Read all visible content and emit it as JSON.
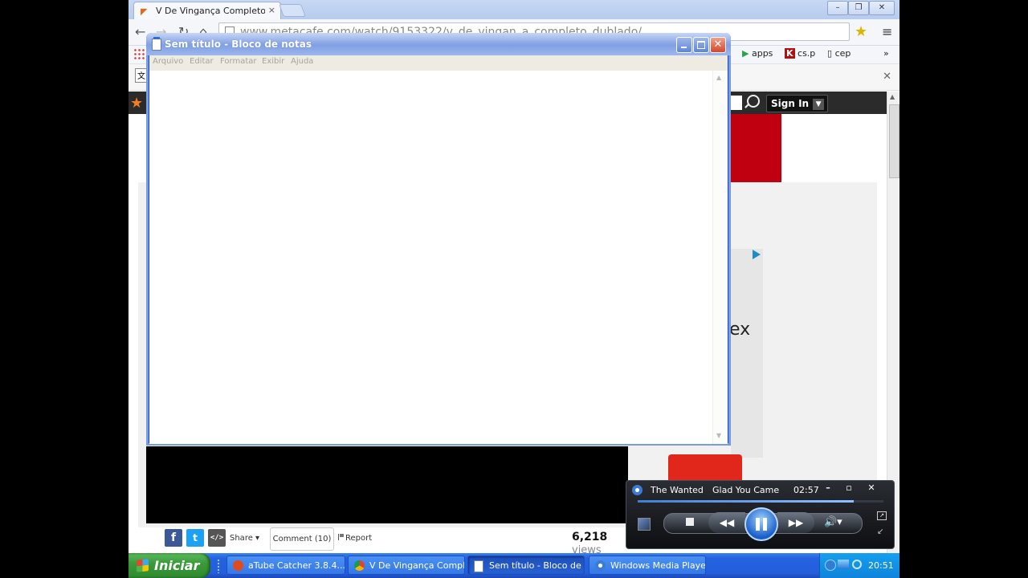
{
  "browser": {
    "tab_title": "V De Vingança Completo Dub",
    "tab_close": "×",
    "url": "www.metacafe.com/watch/9153322/v_de_vingan_a_completo_dublado/",
    "bookmarks": [
      {
        "label": "apps"
      },
      {
        "label": "cs.p"
      },
      {
        "label": "cep"
      }
    ],
    "bookmarks_overflow": "»",
    "window_buttons": {
      "minimize": "–",
      "restore": "❐",
      "close": "✕"
    }
  },
  "site": {
    "signin_label": "Sign In",
    "ad_partial_text": "ex",
    "share": {
      "facebook": "f",
      "twitter": "t",
      "embed": "</>",
      "share_label": "Share ▾",
      "comment_label": "Comment (10)",
      "report_label": "Report",
      "views_count": "6,218",
      "views_word": "views"
    }
  },
  "notepad": {
    "title": "Sem título - Bloco de notas",
    "menu": [
      "Arquivo",
      "Editar",
      "Formatar",
      "Exibir",
      "Ajuda"
    ],
    "content": ""
  },
  "media_player": {
    "artist": "The Wanted",
    "song": "Glad You Came",
    "time": "02:57",
    "progress": 0.88,
    "buttons": {
      "minimize": "–",
      "restore": "▫",
      "close": "✕"
    }
  },
  "taskbar": {
    "start_label": "Iniciar",
    "tasks": [
      {
        "label": "aTube Catcher 3.8.4...",
        "icon": "atube-icon",
        "color": "#e24a1a"
      },
      {
        "label": "V De Vingança Compl...",
        "icon": "chrome-icon",
        "color": "#e8b200"
      },
      {
        "label": "Sem título - Bloco de ...",
        "icon": "notepad-icon",
        "color": "#ffffff"
      },
      {
        "label": "Windows Media Player",
        "icon": "wmp-icon",
        "color": "#3a7bd5"
      }
    ],
    "clock": "20:51"
  }
}
